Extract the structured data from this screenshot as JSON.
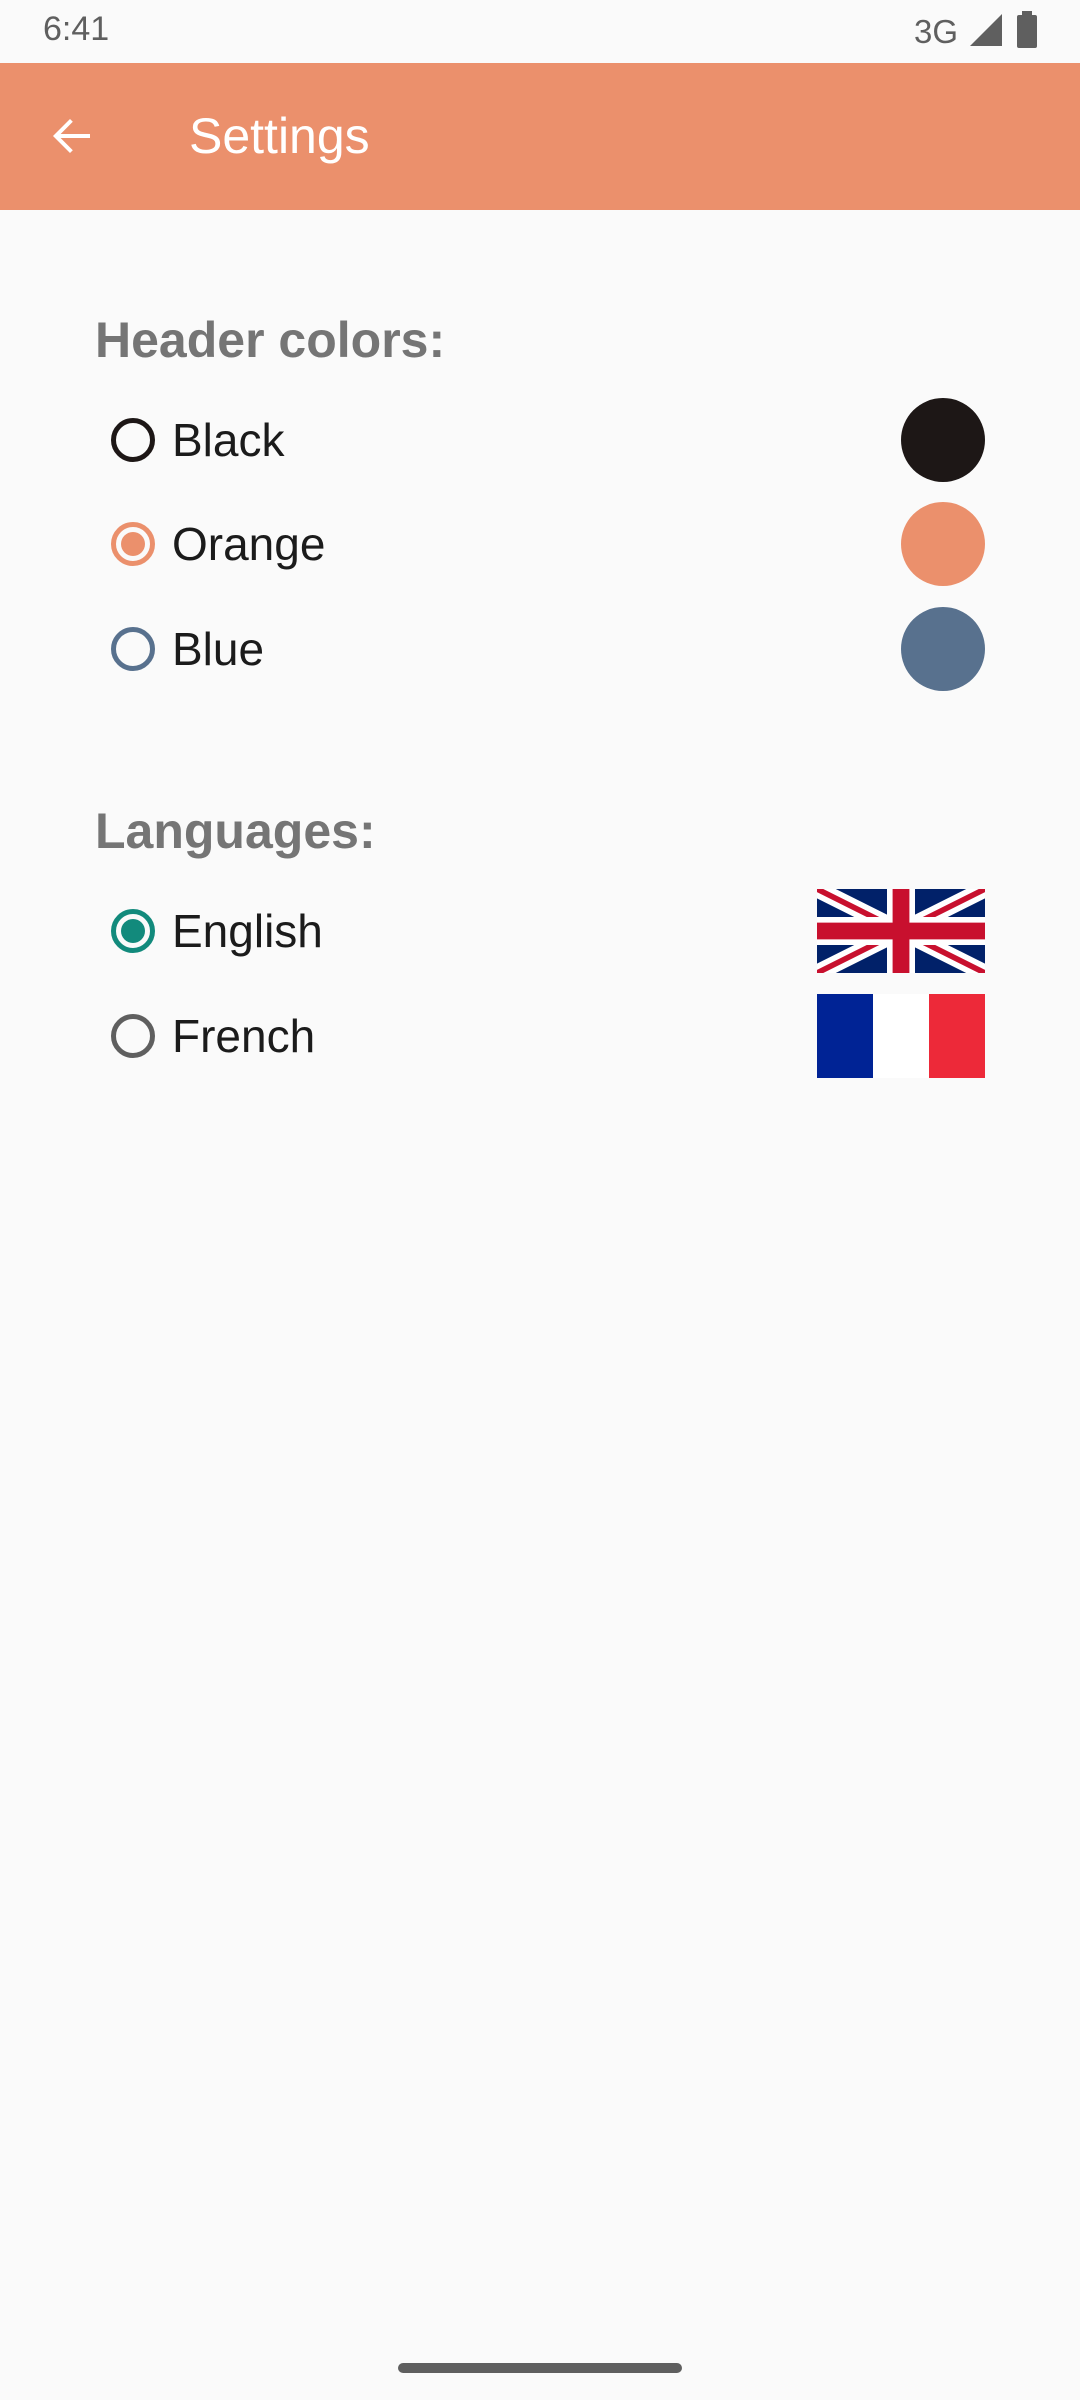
{
  "status_bar": {
    "time": "6:41",
    "network": "3G",
    "signal_icon": "signal-icon",
    "battery_icon": "battery-icon"
  },
  "app_bar": {
    "title": "Settings",
    "back_icon": "arrow-back-icon",
    "color": "#eb906c"
  },
  "header_colors": {
    "title": "Header colors:",
    "options": [
      {
        "label": "Black",
        "selected": false,
        "swatch": "#1d1716"
      },
      {
        "label": "Orange",
        "selected": true,
        "swatch": "#eb906c"
      },
      {
        "label": "Blue",
        "selected": false,
        "swatch": "#58718e"
      }
    ]
  },
  "languages": {
    "title": "Languages:",
    "options": [
      {
        "label": "English",
        "selected": true,
        "flag": "uk-flag-icon"
      },
      {
        "label": "French",
        "selected": false,
        "flag": "france-flag-icon"
      }
    ]
  },
  "colors": {
    "accent_teal": "#128a7c",
    "text_secondary": "#757575"
  }
}
